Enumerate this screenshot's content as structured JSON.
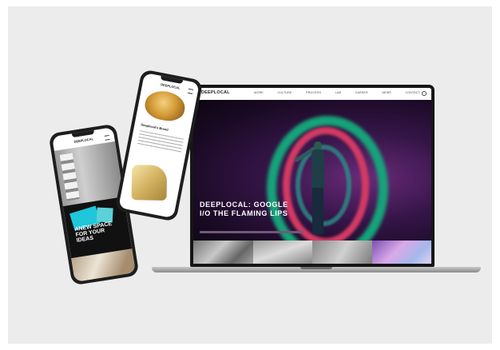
{
  "laptop": {
    "site_logo": "DEEPLOCAL",
    "nav_items": [
      "WORK",
      "CULTURE",
      "PROCESS",
      "LAB",
      "CAREER",
      "NEWS",
      "CONTACT"
    ],
    "hero_headline": "DEEPLOCAL: GOOGLE I/O THE FLAMING LIPS"
  },
  "phone_front": {
    "site_logo": "DEEPLOCAL",
    "article_title": "Deeplocal's Brand"
  },
  "phone_back": {
    "site_logo": "DEEPLOCAL",
    "poster_text": "ANEW SPACE FOR YOUR IDEAS"
  },
  "colors": {
    "backdrop": "#ececec",
    "hero_purple": "#351548",
    "ring_green": "#16a37a",
    "ring_red": "#d23a63"
  }
}
